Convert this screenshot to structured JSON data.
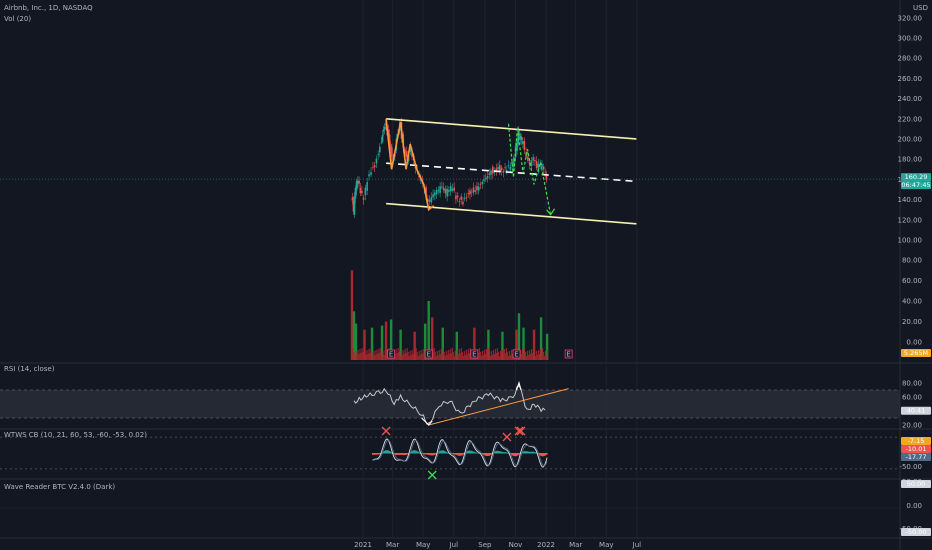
{
  "header": {
    "symbol_title": "Airbnb, Inc., 1D, NASDAQ",
    "volume_label": "Vol (20)",
    "currency": "USD"
  },
  "panes": {
    "rsi_label": "RSI (14, close)",
    "wtws_label": "WTWS CB (10, 21, 60, 53, -60, -53, 0.02)",
    "wave_label": "Wave Reader BTC V2.4.0 (Dark)"
  },
  "markers": {
    "earnings": "E"
  },
  "colors": {
    "background": "#131722",
    "up_candle": "#26a69a",
    "down_candle": "#ef5350",
    "channel": "#f7f0b0",
    "orange_path": "#ff9a3c",
    "green_path": "#3ddc52",
    "rsi_line": "#c8c8c8",
    "rsi_band": "#2a2e39",
    "volume_up": "#1f8a3a",
    "volume_down": "#a8282d"
  },
  "chart_data": [
    {
      "type": "line",
      "pane": "price",
      "title": "Airbnb, Inc., 1D, NASDAQ",
      "x_ticks": [
        "2021",
        "Mar",
        "May",
        "Jul",
        "Sep",
        "Nov",
        "2022",
        "Mar",
        "May",
        "Jul"
      ],
      "y_ticks": [
        "320.00",
        "300.00",
        "280.00",
        "260.00",
        "240.00",
        "220.00",
        "200.00",
        "180.00",
        "160.00",
        "140.00",
        "120.00",
        "100.00",
        "80.00",
        "60.00",
        "40.00",
        "20.00",
        "0.00"
      ],
      "ylim": [
        0,
        330
      ],
      "price_series": [
        {
          "x": "2020-12-10",
          "y": 144
        },
        {
          "x": "2020-12-14",
          "y": 128
        },
        {
          "x": "2020-12-18",
          "y": 152
        },
        {
          "x": "2020-12-23",
          "y": 160
        },
        {
          "x": "2020-12-28",
          "y": 148
        },
        {
          "x": "2021-01-04",
          "y": 142
        },
        {
          "x": "2021-01-11",
          "y": 160
        },
        {
          "x": "2021-01-19",
          "y": 170
        },
        {
          "x": "2021-01-26",
          "y": 175
        },
        {
          "x": "2021-02-02",
          "y": 188
        },
        {
          "x": "2021-02-08",
          "y": 200
        },
        {
          "x": "2021-02-12",
          "y": 212
        },
        {
          "x": "2021-02-16",
          "y": 217
        },
        {
          "x": "2021-02-22",
          "y": 205
        },
        {
          "x": "2021-02-26",
          "y": 190
        },
        {
          "x": "2021-03-04",
          "y": 180
        },
        {
          "x": "2021-03-10",
          "y": 200
        },
        {
          "x": "2021-03-17",
          "y": 215
        },
        {
          "x": "2021-03-24",
          "y": 190
        },
        {
          "x": "2021-03-31",
          "y": 180
        },
        {
          "x": "2021-04-07",
          "y": 190
        },
        {
          "x": "2021-04-14",
          "y": 176
        },
        {
          "x": "2021-04-21",
          "y": 165
        },
        {
          "x": "2021-04-28",
          "y": 158
        },
        {
          "x": "2021-05-05",
          "y": 150
        },
        {
          "x": "2021-05-12",
          "y": 135
        },
        {
          "x": "2021-05-19",
          "y": 140
        },
        {
          "x": "2021-05-26",
          "y": 145
        },
        {
          "x": "2021-06-02",
          "y": 148
        },
        {
          "x": "2021-06-09",
          "y": 152
        },
        {
          "x": "2021-06-16",
          "y": 146
        },
        {
          "x": "2021-06-23",
          "y": 150
        },
        {
          "x": "2021-06-30",
          "y": 152
        },
        {
          "x": "2021-07-07",
          "y": 142
        },
        {
          "x": "2021-07-14",
          "y": 140
        },
        {
          "x": "2021-07-21",
          "y": 138
        },
        {
          "x": "2021-07-28",
          "y": 145
        },
        {
          "x": "2021-08-04",
          "y": 148
        },
        {
          "x": "2021-08-11",
          "y": 150
        },
        {
          "x": "2021-08-18",
          "y": 152
        },
        {
          "x": "2021-08-25",
          "y": 158
        },
        {
          "x": "2021-09-01",
          "y": 162
        },
        {
          "x": "2021-09-08",
          "y": 165
        },
        {
          "x": "2021-09-15",
          "y": 170
        },
        {
          "x": "2021-09-22",
          "y": 168
        },
        {
          "x": "2021-09-29",
          "y": 172
        },
        {
          "x": "2021-10-06",
          "y": 168
        },
        {
          "x": "2021-10-13",
          "y": 170
        },
        {
          "x": "2021-10-20",
          "y": 172
        },
        {
          "x": "2021-10-27",
          "y": 175
        },
        {
          "x": "2021-11-03",
          "y": 190
        },
        {
          "x": "2021-11-08",
          "y": 205
        },
        {
          "x": "2021-11-12",
          "y": 200
        },
        {
          "x": "2021-11-17",
          "y": 195
        },
        {
          "x": "2021-11-24",
          "y": 180
        },
        {
          "x": "2021-12-01",
          "y": 172
        },
        {
          "x": "2021-12-08",
          "y": 180
        },
        {
          "x": "2021-12-15",
          "y": 170
        },
        {
          "x": "2021-12-22",
          "y": 175
        },
        {
          "x": "2021-12-29",
          "y": 170
        },
        {
          "x": "2022-01-03",
          "y": 160
        }
      ],
      "drawings": {
        "channel_upper": [
          {
            "x": "2021-02-16",
            "y": 220
          },
          {
            "x": "2022-06-30",
            "y": 200
          }
        ],
        "channel_mid": [
          {
            "x": "2021-02-16",
            "y": 176
          },
          {
            "x": "2022-06-30",
            "y": 158
          }
        ],
        "channel_lower": [
          {
            "x": "2021-02-16",
            "y": 136
          },
          {
            "x": "2022-06-30",
            "y": 116
          }
        ],
        "orange_path": [
          {
            "x": "2021-02-16",
            "y": 220
          },
          {
            "x": "2021-02-27",
            "y": 170
          },
          {
            "x": "2021-03-17",
            "y": 217
          },
          {
            "x": "2021-03-28",
            "y": 170
          },
          {
            "x": "2021-04-05",
            "y": 195
          },
          {
            "x": "2021-04-18",
            "y": 170
          },
          {
            "x": "2021-05-02",
            "y": 155
          },
          {
            "x": "2021-05-12",
            "y": 130
          },
          {
            "x": "2021-05-22",
            "y": 134
          }
        ],
        "green_path": [
          {
            "x": "2021-10-18",
            "y": 215
          },
          {
            "x": "2021-10-28",
            "y": 162
          },
          {
            "x": "2021-11-05",
            "y": 212
          },
          {
            "x": "2021-11-16",
            "y": 166
          },
          {
            "x": "2021-11-25",
            "y": 190
          },
          {
            "x": "2021-12-08",
            "y": 155
          },
          {
            "x": "2021-12-21",
            "y": 177
          },
          {
            "x": "2022-01-10",
            "y": 125
          }
        ]
      }
    },
    {
      "type": "bar",
      "pane": "volume",
      "title": "Vol (20)",
      "ylim": [
        0,
        80
      ],
      "series": [
        {
          "values": [
            {
              "x": "2020-12-10",
              "y": 70
            },
            {
              "x": "2020-12-14",
              "y": 30
            },
            {
              "x": "2020-12-18",
              "y": 18
            },
            {
              "x": "2021-01-04",
              "y": 12
            },
            {
              "x": "2021-01-19",
              "y": 14
            },
            {
              "x": "2021-02-08",
              "y": 16
            },
            {
              "x": "2021-02-16",
              "y": 20
            },
            {
              "x": "2021-02-26",
              "y": 22
            },
            {
              "x": "2021-03-17",
              "y": 12
            },
            {
              "x": "2021-04-14",
              "y": 10
            },
            {
              "x": "2021-05-05",
              "y": 18
            },
            {
              "x": "2021-05-12",
              "y": 40
            },
            {
              "x": "2021-05-19",
              "y": 24
            },
            {
              "x": "2021-06-09",
              "y": 14
            },
            {
              "x": "2021-07-07",
              "y": 10
            },
            {
              "x": "2021-08-11",
              "y": 14
            },
            {
              "x": "2021-09-08",
              "y": 12
            },
            {
              "x": "2021-10-06",
              "y": 10
            },
            {
              "x": "2021-11-03",
              "y": 12
            },
            {
              "x": "2021-11-08",
              "y": 28
            },
            {
              "x": "2021-11-17",
              "y": 14
            },
            {
              "x": "2021-12-08",
              "y": 12
            },
            {
              "x": "2021-12-22",
              "y": 24
            },
            {
              "x": "2022-01-03",
              "y": 8
            }
          ]
        }
      ]
    },
    {
      "type": "line",
      "pane": "rsi",
      "title": "RSI (14, close)",
      "y_ticks": [
        "80.00",
        "60.00",
        "40.00",
        "20.00"
      ],
      "ylim": [
        20,
        85
      ],
      "band": [
        30,
        70
      ],
      "series": [
        {
          "values": [
            {
              "x": "2020-12-14",
              "y": 52
            },
            {
              "x": "2020-12-28",
              "y": 58
            },
            {
              "x": "2021-01-11",
              "y": 62
            },
            {
              "x": "2021-02-01",
              "y": 66
            },
            {
              "x": "2021-02-16",
              "y": 70
            },
            {
              "x": "2021-03-04",
              "y": 50
            },
            {
              "x": "2021-03-17",
              "y": 60
            },
            {
              "x": "2021-04-07",
              "y": 48
            },
            {
              "x": "2021-04-28",
              "y": 35
            },
            {
              "x": "2021-05-12",
              "y": 20
            },
            {
              "x": "2021-06-02",
              "y": 48
            },
            {
              "x": "2021-06-23",
              "y": 55
            },
            {
              "x": "2021-07-14",
              "y": 35
            },
            {
              "x": "2021-08-11",
              "y": 55
            },
            {
              "x": "2021-09-08",
              "y": 64
            },
            {
              "x": "2021-10-06",
              "y": 55
            },
            {
              "x": "2021-10-27",
              "y": 60
            },
            {
              "x": "2021-11-08",
              "y": 78
            },
            {
              "x": "2021-11-24",
              "y": 40
            },
            {
              "x": "2021-12-08",
              "y": 50
            },
            {
              "x": "2021-12-22",
              "y": 42
            },
            {
              "x": "2022-01-03",
              "y": 40
            }
          ]
        }
      ],
      "last_value_label": "40.41"
    },
    {
      "type": "line",
      "pane": "wtws",
      "title": "WTWS CB (10, 21, 60, 53, -60, -53, 0.02)",
      "y_ticks": [
        "-50.00"
      ],
      "ylim": [
        -70,
        70
      ],
      "value_labels": [
        "-7.15",
        "-10.01",
        "-17.77"
      ]
    },
    {
      "type": "line",
      "pane": "wave_reader",
      "title": "Wave Reader BTC V2.4.0 (Dark)",
      "y_ticks": [
        "50.00",
        "0.00",
        "-50.00"
      ],
      "ylim": [
        -60,
        60
      ],
      "value_labels": [
        "50.00",
        "-50.00"
      ]
    }
  ],
  "price_tags": {
    "current_price": "160.29",
    "countdown": "06:47:45",
    "volume_value": "5.265M"
  }
}
